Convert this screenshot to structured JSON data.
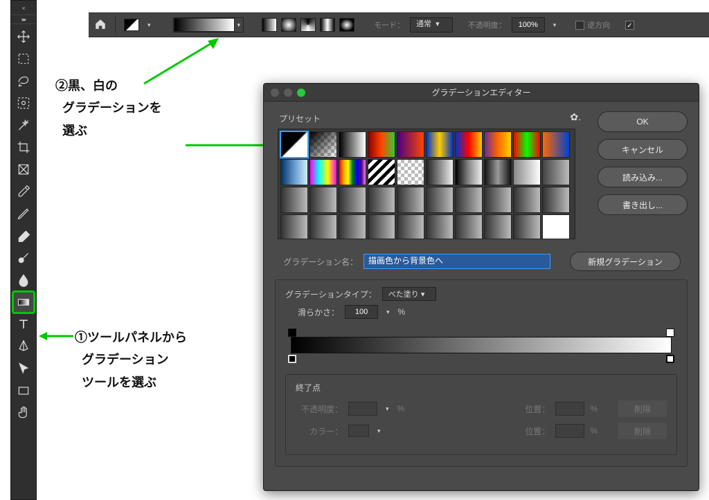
{
  "annotations": {
    "step1_l1": "①ツールパネルから",
    "step1_l2": "グラデーション",
    "step1_l3": "ツールを選ぶ",
    "step2_l1": "②黒、白の",
    "step2_l2": "グラデーションを",
    "step2_l3": "選ぶ"
  },
  "optionbar": {
    "mode_label": "モード：",
    "mode_value": "通常",
    "opacity_label": "不透明度：",
    "opacity_value": "100%",
    "reverse_label": "逆方向"
  },
  "ged": {
    "title": "グラデーションエディター",
    "presets_label": "プリセット",
    "ok": "OK",
    "cancel": "キャンセル",
    "load": "読み込み...",
    "save": "書き出し...",
    "name_label": "グラデーション名：",
    "name_value": "描画色から背景色へ",
    "new_grad": "新規グラデーション",
    "type_label": "グラデーションタイプ：",
    "type_value": "べた塗り",
    "smooth_label": "滑らかさ：",
    "smooth_value": "100",
    "percent": "%",
    "endpoints_title": "終了点",
    "opacity_lbl": "不透明度：",
    "position_lbl": "位置：",
    "color_lbl": "カラー：",
    "delete": "削除"
  },
  "chart_data": {
    "type": "gradient",
    "name": "描画色から背景色へ",
    "gradient_type": "べた塗り",
    "smoothness_pct": 100,
    "stops": [
      {
        "position_pct": 0,
        "color": "#000000",
        "opacity_pct": 100
      },
      {
        "position_pct": 100,
        "color": "#ffffff",
        "opacity_pct": 100
      }
    ]
  }
}
